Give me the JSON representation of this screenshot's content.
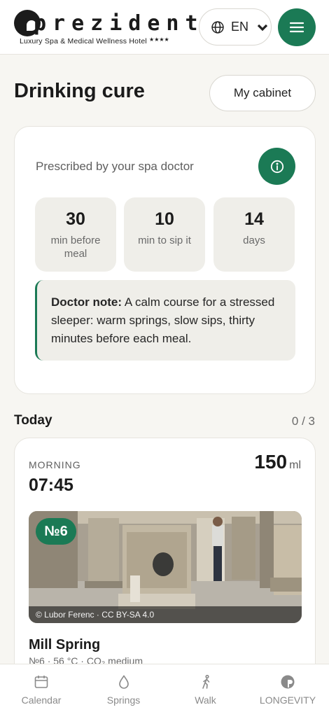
{
  "header": {
    "logo_word": "prezident",
    "logo_subtitle": "Luxury Spa & Medical Wellness Hotel",
    "logo_stars": "★★★★",
    "language": "EN",
    "menu_icon": "hamburger-menu-icon"
  },
  "page": {
    "title": "Drinking cure",
    "cabinet_button": "My cabinet"
  },
  "prescription": {
    "label": "Prescribed by your spa doctor",
    "info_icon": "info-icon",
    "stats": [
      {
        "value": "30",
        "unit": "min before meal"
      },
      {
        "value": "10",
        "unit": "min to sip it"
      },
      {
        "value": "14",
        "unit": "days"
      }
    ],
    "note_label": "Doctor note:",
    "note_text": " A calm course for a stressed sleeper: warm springs, slow sips, thirty minutes before each meal."
  },
  "today": {
    "title": "Today",
    "count": "0 / 3"
  },
  "dose": {
    "period": "MORNING",
    "time": "07:45",
    "amount": "150",
    "amount_unit": "ml",
    "spring_badge": "№6",
    "photo_credit": "© Lubor Ferenc · CC BY-SA 4.0",
    "spring_name": "Mill Spring",
    "spring_meta": "№6 · 56 °C · CO₂ medium"
  },
  "nav": {
    "items": [
      {
        "label": "Calendar",
        "icon": "calendar-icon"
      },
      {
        "label": "Springs",
        "icon": "drop-icon"
      },
      {
        "label": "Walk",
        "icon": "walker-icon"
      },
      {
        "label": "LONGEVITY",
        "icon": "longevity-icon"
      }
    ]
  },
  "colors": {
    "accent": "#1b7a55",
    "background": "#f7f6f2",
    "tile": "#efeee9"
  }
}
